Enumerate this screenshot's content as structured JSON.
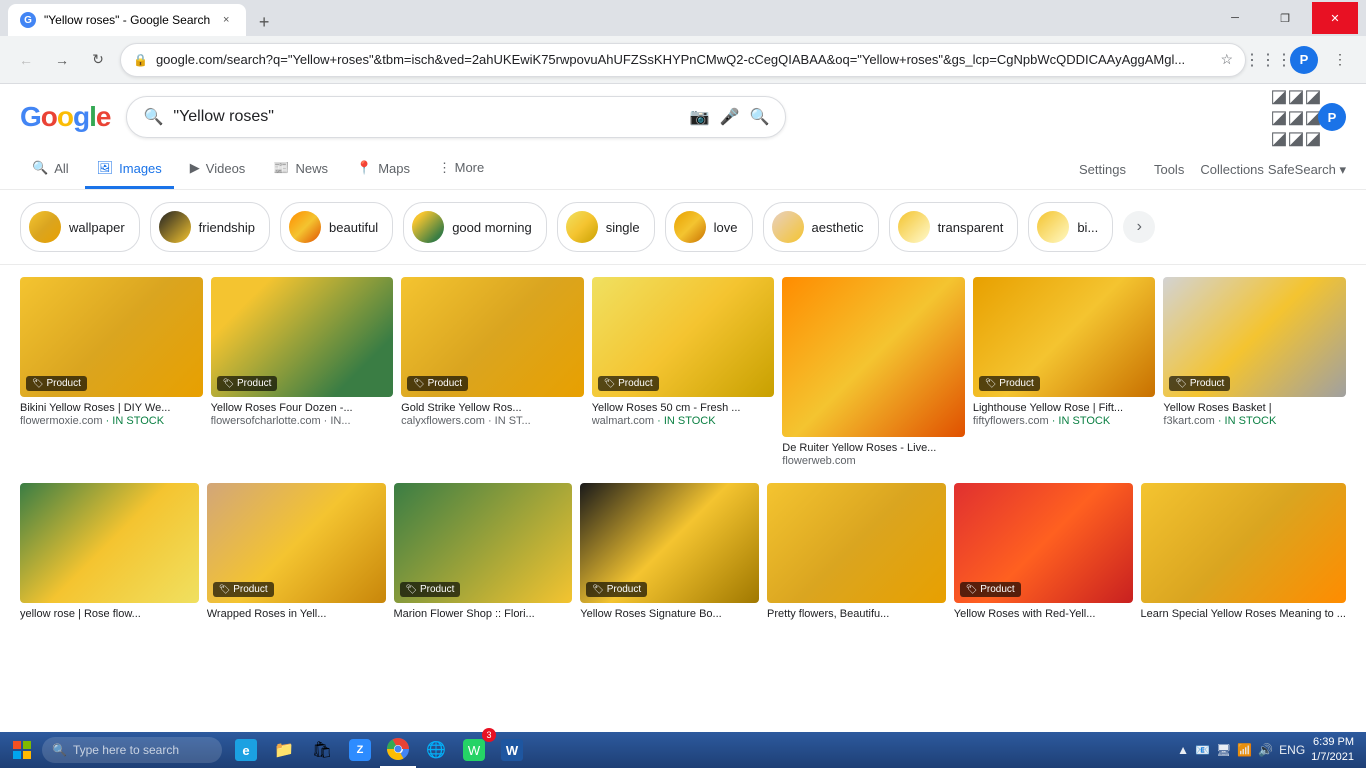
{
  "browser": {
    "tab": {
      "favicon": "G",
      "title": "\"Yellow roses\" - Google Search",
      "close": "×"
    },
    "new_tab": "+",
    "url": "google.com/search?q=\"Yellow+roses\"&tbm=isch&ved=2ahUKEwiK75rwpovuAhUFZSsKHYPnCMwQ2-cCegQIABAA&oq=\"Yellow+roses\"&gs_lcp=CgNpbWcQDDICAAyAggAMgl...",
    "window_controls": {
      "minimize": "─",
      "maximize": "❐",
      "close": "✕"
    }
  },
  "search": {
    "logo": {
      "g1": "G",
      "o1": "o",
      "o2": "o",
      "g2": "g",
      "l": "l",
      "e": "e"
    },
    "query": "\"Yellow roses\"",
    "camera_title": "Search by image",
    "mic_title": "Search by voice",
    "search_title": "Google Search"
  },
  "nav_tabs": [
    {
      "label": "All",
      "icon": "🔍",
      "active": false
    },
    {
      "label": "Images",
      "icon": "🖼",
      "active": true
    },
    {
      "label": "Videos",
      "icon": "▶",
      "active": false
    },
    {
      "label": "News",
      "icon": "📰",
      "active": false
    },
    {
      "label": "Maps",
      "icon": "📍",
      "active": false
    },
    {
      "label": "More",
      "icon": "⋮",
      "active": false
    }
  ],
  "nav_right": {
    "settings": "Settings",
    "tools": "Tools",
    "collections": "Collections",
    "safesearch": "SafeSearch ▾"
  },
  "chips": [
    {
      "label": "wallpaper"
    },
    {
      "label": "friendship"
    },
    {
      "label": "beautiful"
    },
    {
      "label": "good morning"
    },
    {
      "label": "single"
    },
    {
      "label": "love"
    },
    {
      "label": "aesthetic"
    },
    {
      "label": "transparent"
    },
    {
      "label": "bi..."
    }
  ],
  "images_row1": [
    {
      "product": true,
      "product_label": "Product",
      "caption": "Bikini Yellow Roses | DIY We...",
      "source": "flowermoxie.com",
      "stock": "· IN STOCK",
      "color": "rose-yellow"
    },
    {
      "product": true,
      "product_label": "Product",
      "caption": "Yellow Roses Four Dozen -...",
      "source": "flowersofcharlotte.com · IN...",
      "stock": "",
      "color": "rose-yellow-bunch"
    },
    {
      "product": true,
      "product_label": "Product",
      "caption": "Gold Strike Yellow Ros...",
      "source": "calyxflowers.com · IN ST...",
      "stock": "",
      "color": "rose-yellow"
    },
    {
      "product": true,
      "product_label": "Product",
      "caption": "Yellow Roses 50 cm - Fresh ...",
      "source": "walmart.com · IN STOCK",
      "stock": "",
      "color": "rose-yellow-single"
    },
    {
      "product": false,
      "product_label": "",
      "caption": "De Ruiter Yellow Roses - Live...",
      "source": "flowerweb.com",
      "stock": "",
      "color": "rose-orange-yellow"
    },
    {
      "product": true,
      "product_label": "Product",
      "caption": "Lighthouse Yellow Rose | Fift...",
      "source": "fiftyflowers.com · IN STOCK",
      "stock": "",
      "color": "rose-yellow-full"
    },
    {
      "product": true,
      "product_label": "Product",
      "caption": "Yellow Roses Basket |",
      "source": "f3kart.com · IN STOCK",
      "stock": "",
      "color": "rose-basket"
    }
  ],
  "images_row2": [
    {
      "product": false,
      "product_label": "",
      "caption": "yellow rose | Rose flow...",
      "source": "",
      "color": "rose-yellow-single2"
    },
    {
      "product": true,
      "product_label": "Product",
      "caption": "Wrapped Roses in Yell...",
      "source": "",
      "color": "rose-wrap"
    },
    {
      "product": true,
      "product_label": "Product",
      "caption": "Marion Flower Shop :: Flori...",
      "source": "",
      "color": "rose-single3"
    },
    {
      "product": true,
      "product_label": "Product",
      "caption": "Yellow Roses Signature Bo...",
      "source": "",
      "color": "rose-box"
    },
    {
      "product": false,
      "product_label": "",
      "caption": "Pretty flowers, Beautifu...",
      "source": "",
      "color": "rose-yellow"
    },
    {
      "product": true,
      "product_label": "Product",
      "caption": "Yellow Roses with Red-Yell...",
      "source": "",
      "color": "rose-red-orange"
    },
    {
      "product": false,
      "product_label": "",
      "caption": "Learn Special Yellow Roses Meaning to ...",
      "source": "",
      "color": "rose-learn"
    }
  ],
  "taskbar": {
    "search_placeholder": "Type here to search",
    "apps": [
      {
        "icon": "🌐",
        "label": "IE",
        "color": "#1ba1e2",
        "active": false
      },
      {
        "icon": "📁",
        "label": "Explorer",
        "color": "#f0a30a",
        "active": false
      },
      {
        "icon": "🟩",
        "label": "Store",
        "color": "#00b050",
        "active": false
      },
      {
        "icon": "📷",
        "label": "Zoom",
        "color": "#2d8cff",
        "active": false
      },
      {
        "icon": "🔴",
        "label": "Chrome",
        "color": "#4285f4",
        "active": true
      },
      {
        "icon": "🔵",
        "label": "Edge",
        "color": "#0078d7",
        "active": false
      },
      {
        "icon": "🟩",
        "label": "WhatsApp",
        "color": "#25d366",
        "active": false
      },
      {
        "icon": "🔵",
        "label": "Word",
        "color": "#1e56a0",
        "active": false
      }
    ],
    "clock": {
      "time": "6:39 PM",
      "date": "1/7/2021"
    },
    "sys_icons": [
      "▲",
      "📧",
      "🖥",
      "📶",
      "🔊",
      "ENG"
    ]
  }
}
